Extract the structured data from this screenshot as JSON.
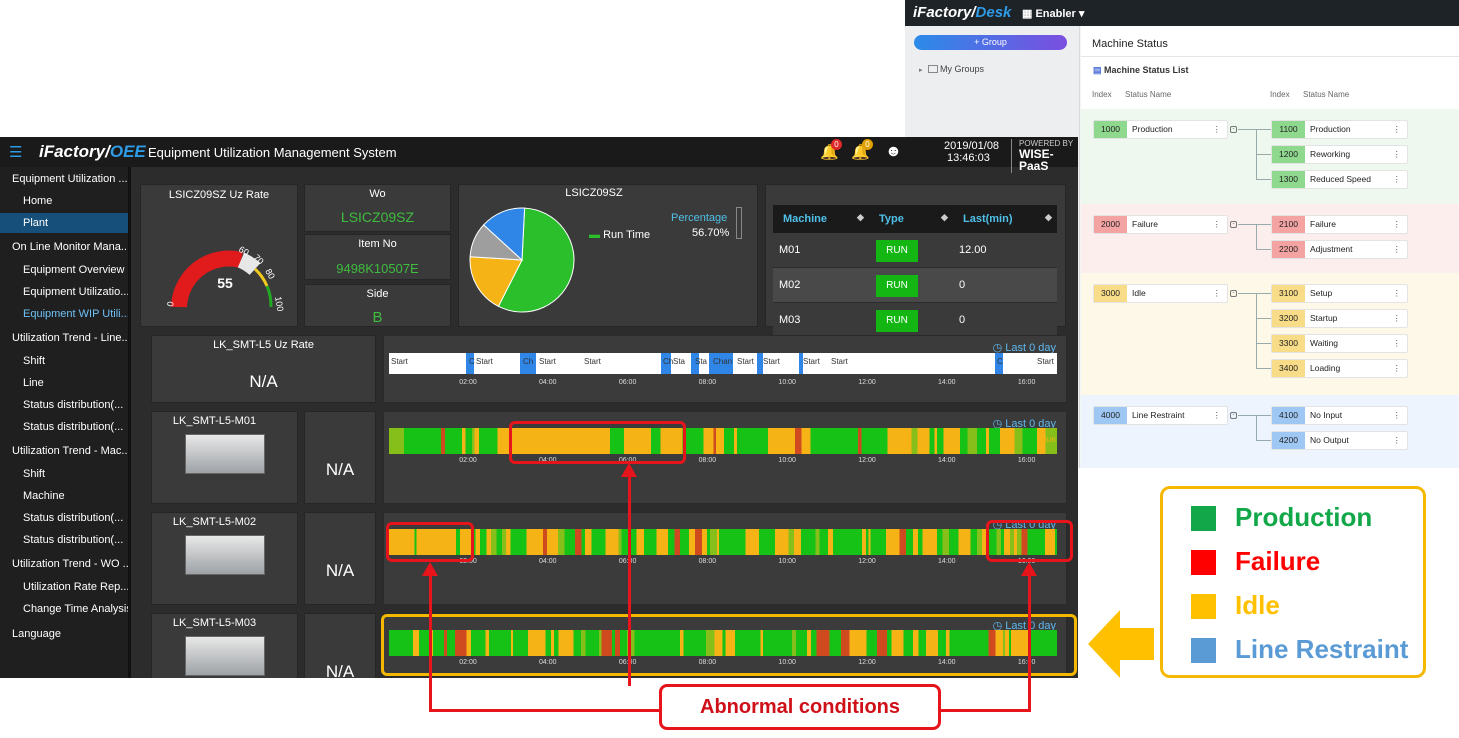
{
  "desk": {
    "brand_main": "iFactory/",
    "brand_sub": "Desk",
    "workspace": "Enabler",
    "group_button": "+ Group",
    "my_groups": "My Groups",
    "page_title": "Machine Status",
    "list_title": "Machine Status List",
    "col_index": "Index",
    "col_status_name": "Status Name",
    "groups": [
      {
        "index": "1000",
        "name": "Production",
        "color": "#8fd98f",
        "bg": "#eef8ee",
        "children": [
          {
            "index": "1100",
            "name": "Production"
          },
          {
            "index": "1200",
            "name": "Reworking"
          },
          {
            "index": "1300",
            "name": "Reduced Speed"
          }
        ]
      },
      {
        "index": "2000",
        "name": "Failure",
        "color": "#f4a3a3",
        "bg": "#fdeeee",
        "children": [
          {
            "index": "2100",
            "name": "Failure"
          },
          {
            "index": "2200",
            "name": "Adjustment"
          }
        ]
      },
      {
        "index": "3000",
        "name": "Idle",
        "color": "#f8dc87",
        "bg": "#fef8e8",
        "children": [
          {
            "index": "3100",
            "name": "Setup"
          },
          {
            "index": "3200",
            "name": "Startup"
          },
          {
            "index": "3300",
            "name": "Waiting"
          },
          {
            "index": "3400",
            "name": "Loading"
          }
        ]
      },
      {
        "index": "4000",
        "name": "Line Restraint",
        "color": "#9ec8f3",
        "bg": "#edf4fd",
        "children": [
          {
            "index": "4100",
            "name": "No Input"
          },
          {
            "index": "4200",
            "name": "No Output"
          }
        ]
      }
    ]
  },
  "oee": {
    "logo_main": "iFactory/",
    "logo_sub": "OEE",
    "system_title": "Equipment Utilization Management System",
    "badge_red": "0",
    "badge_yellow": "0",
    "date": "2019/01/08",
    "time": "13:46:03",
    "powered_by": "POWERED BY",
    "powered_name": "WISE-PaaS",
    "nav": [
      {
        "label": "Equipment Utilization ...",
        "level": "top",
        "state": ""
      },
      {
        "label": "Home",
        "level": "sub",
        "state": ""
      },
      {
        "label": "Plant",
        "level": "sub",
        "state": "sel"
      },
      {
        "label": "On Line Monitor Mana...",
        "level": "top",
        "state": ""
      },
      {
        "label": "Equipment Overview",
        "level": "sub",
        "state": ""
      },
      {
        "label": "Equipment Utilizatio...",
        "level": "sub",
        "state": ""
      },
      {
        "label": "Equipment WIP Utili...",
        "level": "sub",
        "state": "hl"
      },
      {
        "label": "Utilization Trend - Line...",
        "level": "top",
        "state": ""
      },
      {
        "label": "Shift",
        "level": "sub",
        "state": ""
      },
      {
        "label": "Line",
        "level": "sub",
        "state": ""
      },
      {
        "label": "Status distribution(...",
        "level": "sub",
        "state": ""
      },
      {
        "label": "Status distribution(...",
        "level": "sub",
        "state": ""
      },
      {
        "label": "Utilization Trend - Mac...",
        "level": "top",
        "state": ""
      },
      {
        "label": "Shift",
        "level": "sub",
        "state": ""
      },
      {
        "label": "Machine",
        "level": "sub",
        "state": ""
      },
      {
        "label": "Status distribution(...",
        "level": "sub",
        "state": ""
      },
      {
        "label": "Status distribution(...",
        "level": "sub",
        "state": ""
      },
      {
        "label": "Utilization Trend - WO ...",
        "level": "top",
        "state": ""
      },
      {
        "label": "Utilization Rate Rep...",
        "level": "sub",
        "state": ""
      },
      {
        "label": "Change Time Analysis",
        "level": "sub",
        "state": ""
      },
      {
        "label": "Language",
        "level": "top",
        "state": ""
      }
    ],
    "gauge": {
      "title": "LSICZ09SZ Uz Rate",
      "value": "55",
      "value_num": 55,
      "ticks": [
        "0",
        "60",
        "70",
        "80",
        "100"
      ]
    },
    "wo": {
      "label": "Wo",
      "value": "LSICZ09SZ"
    },
    "item": {
      "label": "Item No",
      "value": "9498K10507E"
    },
    "side": {
      "label": "Side",
      "value": "B"
    },
    "pie": {
      "title": "LSICZ09SZ",
      "legend": "Run Time",
      "pct_label": "Percentage",
      "pct_value": "56.70%",
      "slices": [
        {
          "name": "Run Time",
          "value": 56.7,
          "color": "#2bbf2b"
        },
        {
          "name": "",
          "value": 18.5,
          "color": "#f5b316"
        },
        {
          "name": "",
          "value": 10.8,
          "color": "#9e9e9e"
        },
        {
          "name": "",
          "value": 14.0,
          "color": "#2f86e6"
        }
      ]
    },
    "table": {
      "headers": [
        "Machine",
        "Type",
        "Last(min)"
      ],
      "rows": [
        {
          "machine": "M01",
          "type": "RUN",
          "last": "12.00"
        },
        {
          "machine": "M02",
          "type": "RUN",
          "last": "0"
        },
        {
          "machine": "M03",
          "type": "RUN",
          "last": "0"
        }
      ]
    },
    "line_rate": {
      "title": "LK_SMT-L5 Uz Rate",
      "value": "N/A"
    },
    "last_day": "Last 0 day",
    "time_ticks": [
      "02:00",
      "04:00",
      "06:00",
      "08:00",
      "10:00",
      "12:00",
      "14:00",
      "16:00"
    ],
    "line_timeline": [
      {
        "text": "Start"
      },
      {
        "text": "C"
      },
      {
        "text": "Start"
      },
      {
        "text": "Ch"
      },
      {
        "text": "Start"
      },
      {
        "text": "Start"
      },
      {
        "text": "Ch"
      },
      {
        "text": "Sta"
      },
      {
        "text": "Sta"
      },
      {
        "text": "Chan"
      },
      {
        "text": "Start"
      },
      {
        "text": "Start"
      },
      {
        "text": "Start"
      },
      {
        "text": "Start"
      },
      {
        "text": "C"
      },
      {
        "text": "Start"
      }
    ],
    "run_tag": "Run",
    "machines": [
      {
        "name": "LK_SMT-L5-M01",
        "value": "N/A"
      },
      {
        "name": "LK_SMT-L5-M02",
        "value": "N/A"
      },
      {
        "name": "LK_SMT-L5-M03",
        "value": "N/A"
      }
    ]
  },
  "annotation": {
    "abnormal": "Abnormal conditions",
    "legend": [
      {
        "label": "Production",
        "color": "#12a84a",
        "text_color": "#12a84a"
      },
      {
        "label": "Failure",
        "color": "#ff0000",
        "text_color": "#ff0000"
      },
      {
        "label": "Idle",
        "color": "#ffc000",
        "text_color": "#ffc000"
      },
      {
        "label": "Line Restraint",
        "color": "#5b9bd5",
        "text_color": "#5b9bd5"
      }
    ]
  }
}
